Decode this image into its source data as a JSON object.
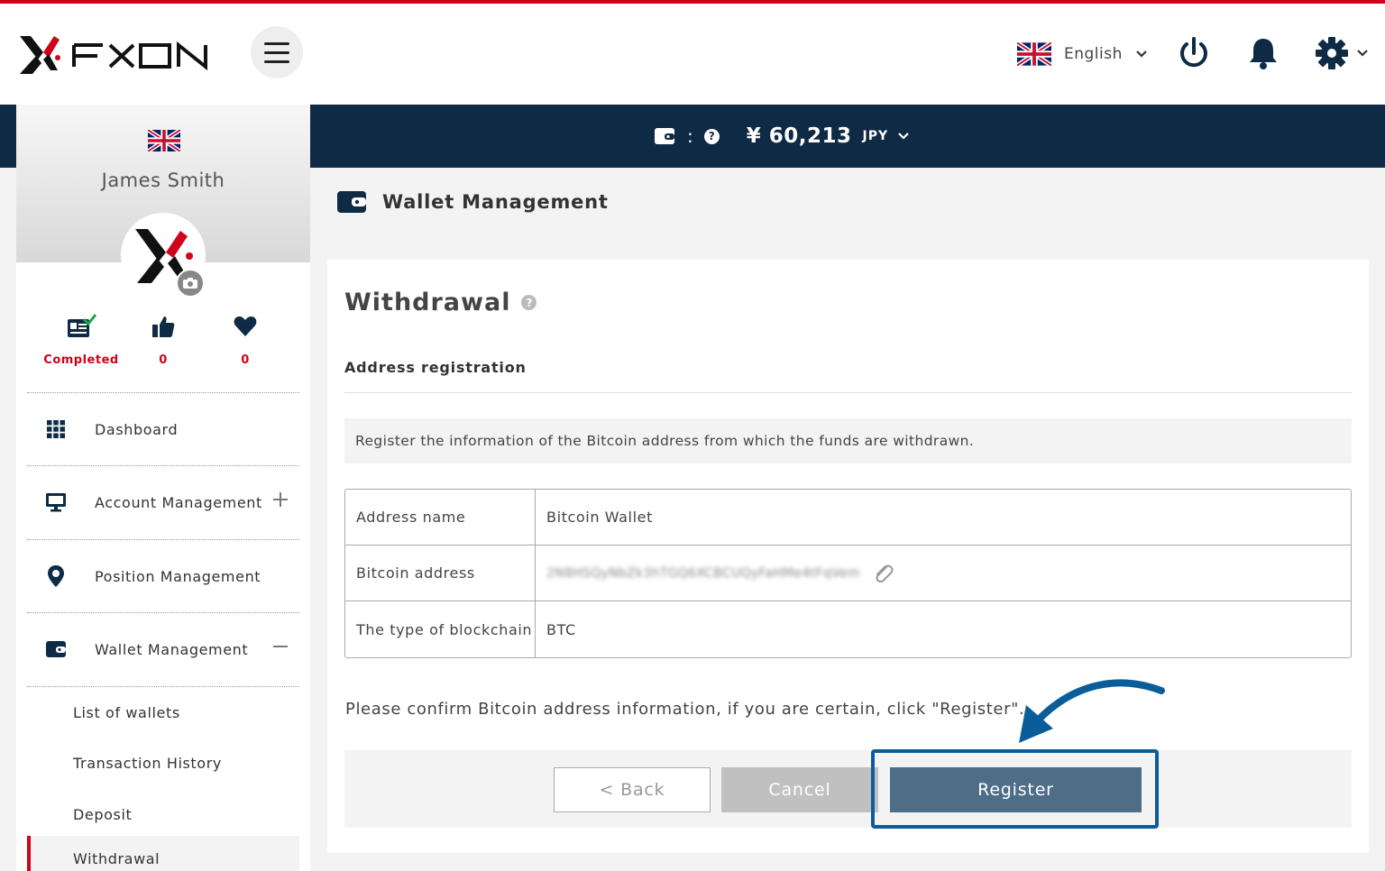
{
  "header": {
    "brand": "FXON",
    "language": "English",
    "icons": {
      "menu": "hamburger-icon",
      "power": "power-icon",
      "notifications": "bell-icon",
      "settings": "gear-icon"
    },
    "accent_color": "#d0021b"
  },
  "balance_bar": {
    "colon": ":",
    "help": "?",
    "amount": "¥ 60,213",
    "currency": "JPY",
    "background": "#0e2a45"
  },
  "sidebar": {
    "user_name": "James Smith",
    "stats": [
      {
        "icon": "id-card-check-icon",
        "value": "Completed"
      },
      {
        "icon": "thumbs-up-icon",
        "value": "0"
      },
      {
        "icon": "heart-icon",
        "value": "0"
      }
    ],
    "menu": [
      {
        "icon": "grid-icon",
        "label": "Dashboard"
      },
      {
        "icon": "monitor-icon",
        "label": "Account Management"
      },
      {
        "icon": "map-pin-icon",
        "label": "Position Management"
      },
      {
        "icon": "wallet-icon",
        "label": "Wallet Management"
      }
    ],
    "submenu": [
      {
        "label": "List of wallets"
      },
      {
        "label": "Transaction History"
      },
      {
        "label": "Deposit"
      },
      {
        "label": "Withdrawal"
      }
    ]
  },
  "main": {
    "page_title": "Wallet Management",
    "card_title": "Withdrawal",
    "help": "?",
    "section_title": "Address registration",
    "info_text": "Register the information of the Bitcoin address from which the funds are withdrawn.",
    "table": [
      {
        "label": "Address name",
        "value": "Bitcoin Wallet"
      },
      {
        "label": "Bitcoin address",
        "value": "2N8HSQyNbZk3hTGQ6XCBCUQyFaHMe4tFqVem"
      },
      {
        "label": "The type of blockchain",
        "value": "BTC"
      }
    ],
    "confirm_text": "Please confirm Bitcoin address information, if you are certain, click \"Register\".",
    "buttons": {
      "back": "< Back",
      "cancel": "Cancel",
      "register": "Register"
    },
    "highlight_color": "#0b5d99"
  }
}
